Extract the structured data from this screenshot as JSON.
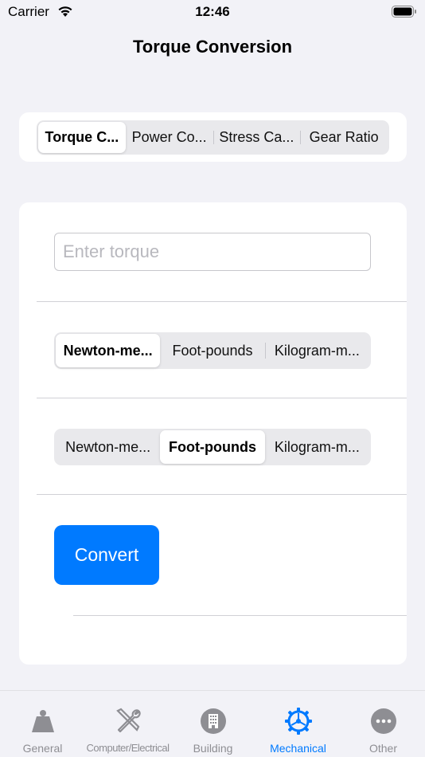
{
  "status_bar": {
    "carrier": "Carrier",
    "time": "12:46"
  },
  "nav": {
    "title": "Torque Conversion"
  },
  "top_segments": {
    "items": [
      "Torque C...",
      "Power Co...",
      "Stress Ca...",
      "Gear Ratio"
    ],
    "selected_index": 0
  },
  "form": {
    "torque_placeholder": "Enter torque",
    "torque_value": "",
    "from_units": {
      "items": [
        "Newton-me...",
        "Foot-pounds",
        "Kilogram-m..."
      ],
      "selected_index": 0
    },
    "to_units": {
      "items": [
        "Newton-me...",
        "Foot-pounds",
        "Kilogram-m..."
      ],
      "selected_index": 1
    },
    "convert_label": "Convert",
    "result": ""
  },
  "tab_bar": {
    "items": [
      {
        "label": "General",
        "icon": "weight-icon"
      },
      {
        "label": "Computer/Electrical",
        "icon": "tools-icon"
      },
      {
        "label": "Building",
        "icon": "building-icon"
      },
      {
        "label": "Mechanical",
        "icon": "gear-icon"
      },
      {
        "label": "Other",
        "icon": "ellipsis-icon"
      }
    ],
    "active_index": 3
  },
  "colors": {
    "accent": "#007aff",
    "background": "#f2f2f7",
    "card": "#ffffff",
    "inactive_tab": "#8e8e93"
  }
}
